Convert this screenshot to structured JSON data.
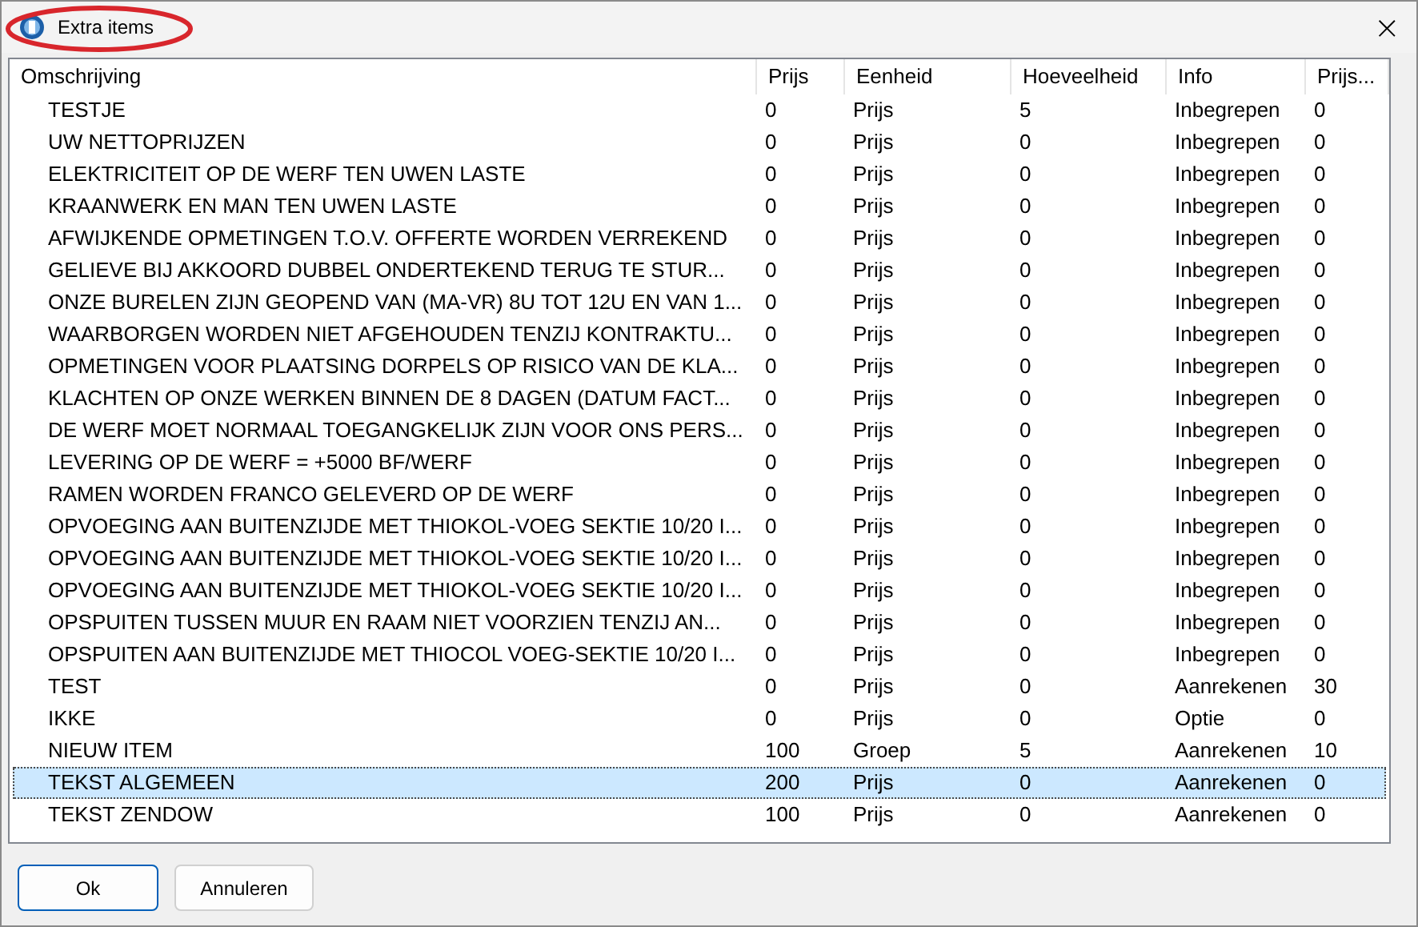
{
  "window": {
    "title": "Extra items",
    "close": "×"
  },
  "table": {
    "columns": [
      "Omschrijving",
      "Prijs",
      "Eenheid",
      "Hoeveelheid",
      "Info",
      "Prijs..."
    ],
    "rows": [
      {
        "cells": [
          "TESTJE",
          "0",
          "Prijs",
          "5",
          "Inbegrepen",
          "0"
        ],
        "selected": false
      },
      {
        "cells": [
          "UW NETTOPRIJZEN",
          "0",
          "Prijs",
          "0",
          "Inbegrepen",
          "0"
        ],
        "selected": false
      },
      {
        "cells": [
          "ELEKTRICITEIT OP DE WERF TEN UWEN LASTE",
          "0",
          "Prijs",
          "0",
          "Inbegrepen",
          "0"
        ],
        "selected": false
      },
      {
        "cells": [
          "KRAANWERK EN MAN TEN UWEN LASTE",
          "0",
          "Prijs",
          "0",
          "Inbegrepen",
          "0"
        ],
        "selected": false
      },
      {
        "cells": [
          "AFWIJKENDE OPMETINGEN T.O.V. OFFERTE WORDEN VERREKEND",
          "0",
          "Prijs",
          "0",
          "Inbegrepen",
          "0"
        ],
        "selected": false
      },
      {
        "cells": [
          "GELIEVE BIJ AKKOORD DUBBEL ONDERTEKEND TERUG TE STUR...",
          "0",
          "Prijs",
          "0",
          "Inbegrepen",
          "0"
        ],
        "selected": false
      },
      {
        "cells": [
          "ONZE BURELEN ZIJN GEOPEND VAN (MA-VR) 8U TOT 12U EN VAN 1...",
          "0",
          "Prijs",
          "0",
          "Inbegrepen",
          "0"
        ],
        "selected": false
      },
      {
        "cells": [
          "WAARBORGEN WORDEN NIET AFGEHOUDEN TENZIJ KONTRAKTU...",
          "0",
          "Prijs",
          "0",
          "Inbegrepen",
          "0"
        ],
        "selected": false
      },
      {
        "cells": [
          "OPMETINGEN VOOR PLAATSING DORPELS OP RISICO VAN DE KLA...",
          "0",
          "Prijs",
          "0",
          "Inbegrepen",
          "0"
        ],
        "selected": false
      },
      {
        "cells": [
          "KLACHTEN OP ONZE WERKEN BINNEN DE 8 DAGEN (DATUM FACT...",
          "0",
          "Prijs",
          "0",
          "Inbegrepen",
          "0"
        ],
        "selected": false
      },
      {
        "cells": [
          "DE WERF MOET NORMAAL TOEGANGKELIJK ZIJN VOOR ONS PERS...",
          "0",
          "Prijs",
          "0",
          "Inbegrepen",
          "0"
        ],
        "selected": false
      },
      {
        "cells": [
          "LEVERING OP DE WERF = +5000 BF/WERF",
          "0",
          "Prijs",
          "0",
          "Inbegrepen",
          "0"
        ],
        "selected": false
      },
      {
        "cells": [
          "RAMEN WORDEN FRANCO GELEVERD OP DE WERF",
          "0",
          "Prijs",
          "0",
          "Inbegrepen",
          "0"
        ],
        "selected": false
      },
      {
        "cells": [
          "OPVOEGING AAN BUITENZIJDE MET THIOKOL-VOEG SEKTIE 10/20 I...",
          "0",
          "Prijs",
          "0",
          "Inbegrepen",
          "0"
        ],
        "selected": false
      },
      {
        "cells": [
          "OPVOEGING AAN BUITENZIJDE MET THIOKOL-VOEG SEKTIE 10/20 I...",
          "0",
          "Prijs",
          "0",
          "Inbegrepen",
          "0"
        ],
        "selected": false
      },
      {
        "cells": [
          "OPVOEGING AAN BUITENZIJDE MET THIOKOL-VOEG SEKTIE 10/20 I...",
          "0",
          "Prijs",
          "0",
          "Inbegrepen",
          "0"
        ],
        "selected": false
      },
      {
        "cells": [
          "OPSPUITEN TUSSEN MUUR EN RAAM NIET VOORZIEN TENZIJ AN...",
          "0",
          "Prijs",
          "0",
          "Inbegrepen",
          "0"
        ],
        "selected": false
      },
      {
        "cells": [
          "OPSPUITEN AAN BUITENZIJDE MET THIOCOL VOEG-SEKTIE 10/20 I...",
          "0",
          "Prijs",
          "0",
          "Inbegrepen",
          "0"
        ],
        "selected": false
      },
      {
        "cells": [
          "TEST",
          "0",
          "Prijs",
          "0",
          "Aanrekenen",
          "30"
        ],
        "selected": false
      },
      {
        "cells": [
          "IKKE",
          "0",
          "Prijs",
          "0",
          "Optie",
          "0"
        ],
        "selected": false
      },
      {
        "cells": [
          "NIEUW ITEM",
          "100",
          "Groep",
          "5",
          "Aanrekenen",
          "10"
        ],
        "selected": false
      },
      {
        "cells": [
          "TEKST ALGEMEEN",
          "200",
          "Prijs",
          "0",
          "Aanrekenen",
          "0"
        ],
        "selected": true
      },
      {
        "cells": [
          "TEKST ZENDOW",
          "100",
          "Prijs",
          "0",
          "Aanrekenen",
          "0"
        ],
        "selected": false
      }
    ]
  },
  "buttons": [
    {
      "label": "Ok",
      "kind": "default"
    },
    {
      "label": "Annuleren",
      "kind": "normal"
    }
  ]
}
